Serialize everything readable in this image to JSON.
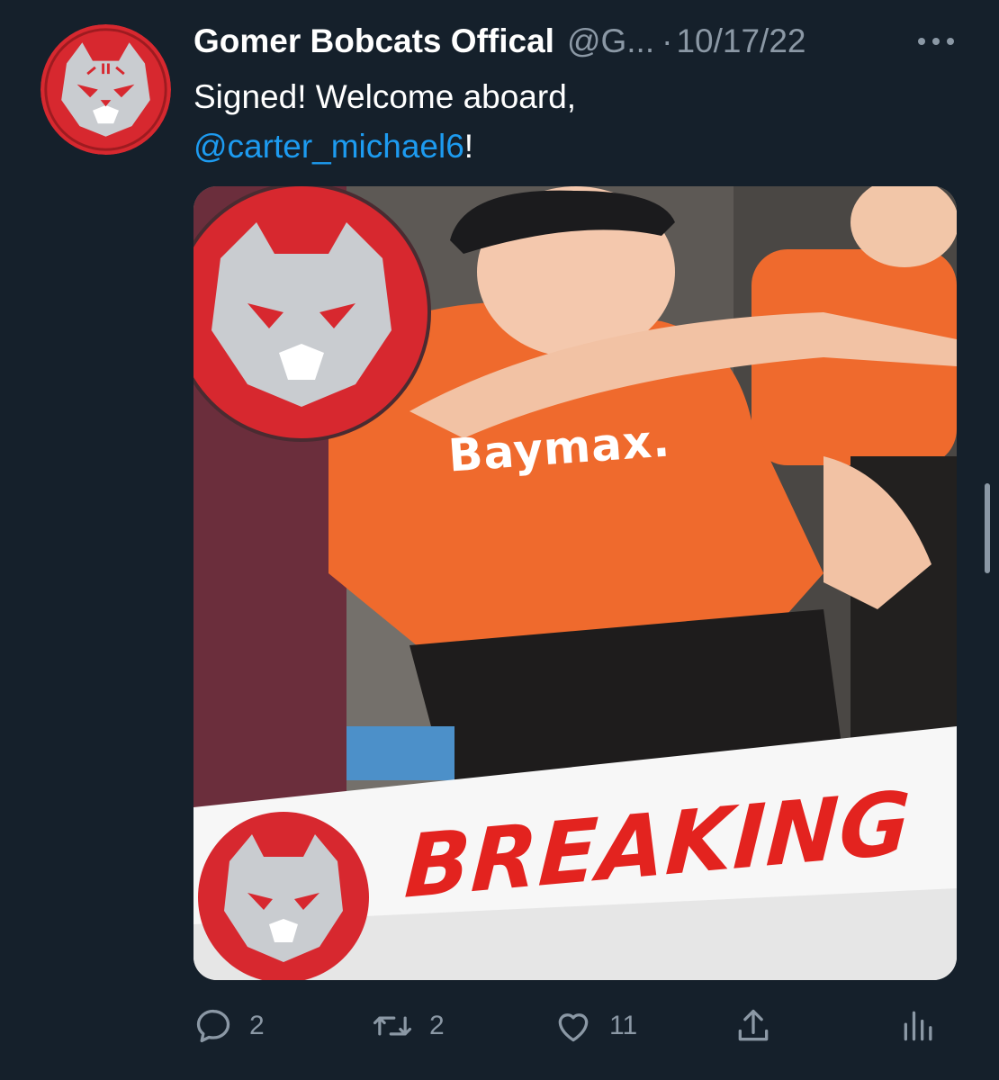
{
  "tweet": {
    "display_name": "Gomer Bobcats Offical",
    "handle": "@G...",
    "separator": "·",
    "date": "10/17/22",
    "text_line1": "Signed! Welcome aboard,",
    "mention": "@carter_michael6",
    "text_tail": "!"
  },
  "media": {
    "shirt_text": "Baymax.",
    "banner_text": "BREAKING"
  },
  "actions": {
    "replies": "2",
    "retweets": "2",
    "likes": "11"
  },
  "colors": {
    "background": "#15202b",
    "accent": "#1d9bf0",
    "muted": "#8b98a5",
    "logo_red": "#d7282f",
    "shirt_orange": "#ef6a2d",
    "breaking_red": "#e3231f"
  },
  "icons": {
    "reply": "reply-icon",
    "retweet": "retweet-icon",
    "like": "heart-icon",
    "share": "share-icon",
    "analytics": "analytics-icon",
    "more": "more-icon"
  }
}
